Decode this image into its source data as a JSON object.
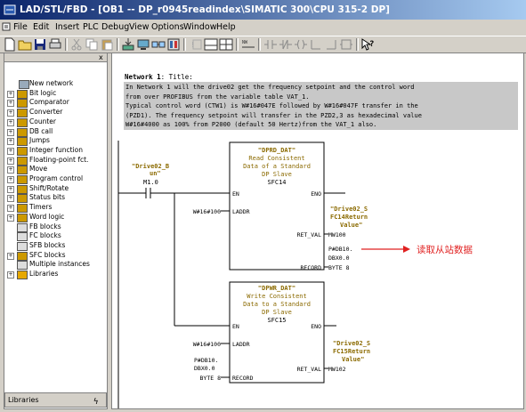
{
  "window": {
    "title": "LAD/STL/FBD - [OB1 -- DP_r0945readindex\\SIMATIC 300\\CPU 315-2 DP]"
  },
  "menu": [
    "File",
    "Edit",
    "Insert",
    "PLC",
    "Debug",
    "View",
    "Options",
    "Window",
    "Help"
  ],
  "toolbar": {
    "icons": [
      "new-icon",
      "open-icon",
      "save-icon",
      "print-icon",
      "cut-icon",
      "copy-icon",
      "paste-icon",
      "download-icon",
      "monitor-icon",
      "accessible-nodes-icon",
      "module-info-icon",
      "overview-icon",
      "detail-view-icon",
      "network-icon",
      "contact-no-icon",
      "contact-nc-icon",
      "coil-icon",
      "branch-open-icon",
      "branch-close-icon",
      "help-icon"
    ]
  },
  "catalog": {
    "items": [
      {
        "label": "New network",
        "expandable": false
      },
      {
        "label": "Bit logic",
        "expandable": true
      },
      {
        "label": "Comparator",
        "expandable": true
      },
      {
        "label": "Converter",
        "expandable": true
      },
      {
        "label": "Counter",
        "expandable": true
      },
      {
        "label": "DB call",
        "expandable": true
      },
      {
        "label": "Jumps",
        "expandable": true
      },
      {
        "label": "Integer function",
        "expandable": true
      },
      {
        "label": "Floating-point fct.",
        "expandable": true
      },
      {
        "label": "Move",
        "expandable": true
      },
      {
        "label": "Program control",
        "expandable": true
      },
      {
        "label": "Shift/Rotate",
        "expandable": true
      },
      {
        "label": "Status bits",
        "expandable": true
      },
      {
        "label": "Timers",
        "expandable": true
      },
      {
        "label": "Word logic",
        "expandable": true
      },
      {
        "label": "FB blocks",
        "expandable": false
      },
      {
        "label": "FC blocks",
        "expandable": false
      },
      {
        "label": "SFB blocks",
        "expandable": false
      },
      {
        "label": "SFC blocks",
        "expandable": true
      },
      {
        "label": "Multiple instances",
        "expandable": false
      },
      {
        "label": "Libraries",
        "expandable": true
      }
    ],
    "status_label": "Libraries",
    "close_glyph": "x"
  },
  "network": {
    "number_label": "Network 1",
    "title_label": ": Title:",
    "comment_lines": [
      "In Network 1 will the drive02 get the frequency setpoint and the control word",
      "from over PROFIBUS from the variable table VAT_1.",
      "Typical control word (CTW1) is W#16#047E followed by W#16#047F transfer in the",
      "(PZD1). The frequency setpoint will transfer in the PZD2,3 as hexadecimal value",
      "W#16#4000 as 100% from P2000 (default 50 Hertz)from the VAT_1 also."
    ],
    "contact": {
      "symbol_line1": "\"Drive02_B",
      "symbol_line2": "un\"",
      "address": "M1.0"
    },
    "block1": {
      "name": "\"DPRD_DAT\"",
      "desc": [
        "Read Consistent",
        "Data of a Standard",
        "DP Slave"
      ],
      "number": "SFC14",
      "en": "EN",
      "eno": "ENO",
      "in_pins": [
        "LADDR",
        "RECORD"
      ],
      "out_pins": [
        "RET_VAL"
      ],
      "laddr_value": "W#16#100",
      "retval_symbol": [
        "\"Drive02_S",
        "FC14Return",
        "Value\""
      ],
      "retval_addr": "MW100",
      "record_values": [
        "P#DB10.",
        "DBX0.0",
        "BYTE 8"
      ]
    },
    "block2": {
      "name": "\"DPWR_DAT\"",
      "desc": [
        "Write Consistent",
        "Data to a Standard",
        "DP Slave"
      ],
      "number": "SFC15",
      "en": "EN",
      "eno": "ENO",
      "in_pins": [
        "LADDR",
        "RECORD"
      ],
      "out_pins": [
        "RET_VAL"
      ],
      "laddr_value": "W#16#100",
      "record_values": [
        "P#DB10.",
        "DBX0.0",
        "BYTE 8"
      ],
      "retval_symbol": [
        "\"Drive02_S",
        "FC15Return",
        "Value\""
      ],
      "retval_addr": "MW102"
    },
    "annotation": "读取从站数据",
    "colors": {
      "symbol": "#8b6a00",
      "annotation": "#e02020",
      "comment_bg": "#c8c8c8",
      "wire": "#000000"
    }
  }
}
